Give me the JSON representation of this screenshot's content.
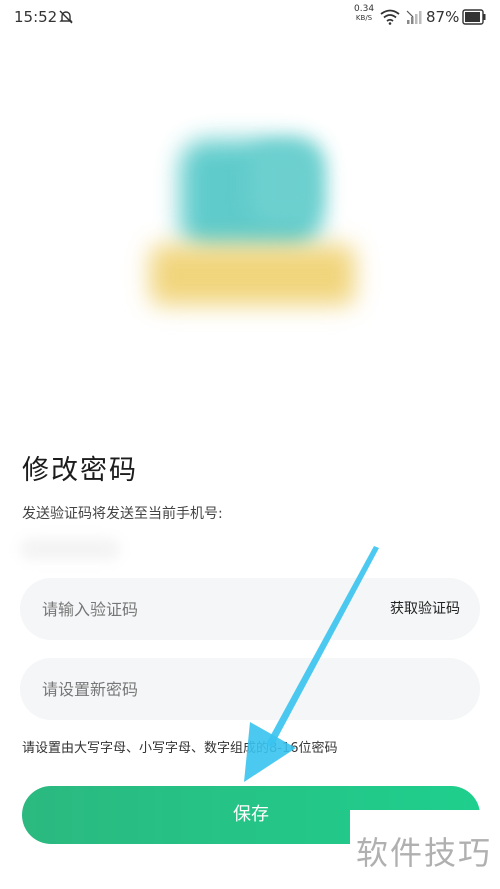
{
  "status_bar": {
    "time": "15:52",
    "net_speed_value": "0.34",
    "net_speed_unit": "KB/S",
    "battery": "87%",
    "icons": [
      "bell-muted-icon",
      "wifi-icon",
      "signal-icon",
      "battery-icon"
    ]
  },
  "page": {
    "title": "修改密码",
    "hint": "发送验证码将发送至当前手机号:"
  },
  "form": {
    "code_placeholder": "请输入验证码",
    "get_code_label": "获取验证码",
    "password_placeholder": "请设置新密码",
    "rule_text": "请设置由大写字母、小写字母、数字组成的8-16位密码",
    "save_label": "保存"
  },
  "watermark": {
    "text": "软件技巧"
  },
  "colors": {
    "accent_green": "#2bb980",
    "arrow_blue": "#39c3ee"
  }
}
